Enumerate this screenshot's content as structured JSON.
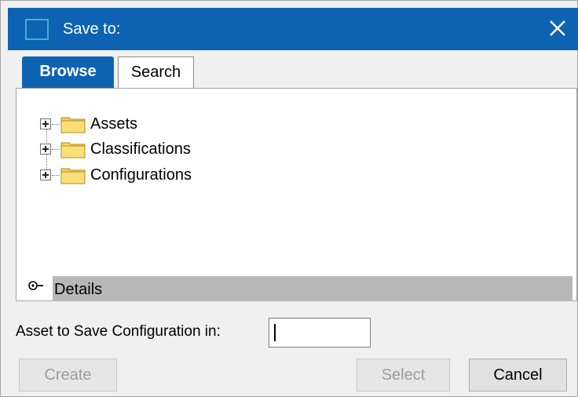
{
  "window": {
    "title": "Save to:"
  },
  "tabs": [
    {
      "label": "Browse",
      "active": true
    },
    {
      "label": "Search",
      "active": false
    }
  ],
  "tree": {
    "items": [
      {
        "label": "Assets",
        "icon": "folder-icon"
      },
      {
        "label": "Classifications",
        "icon": "folder-icon"
      },
      {
        "label": "Configurations",
        "icon": "folder-icon"
      }
    ]
  },
  "details": {
    "label": "Details"
  },
  "asset_field": {
    "label": "Asset to Save Configuration in:",
    "value": ""
  },
  "buttons": {
    "create": "Create",
    "select": "Select",
    "cancel": "Cancel"
  },
  "colors": {
    "titlebar": "#0d63b1",
    "tab_active": "#0d63b1",
    "folder": "#f7d35b",
    "details_bar": "#b8b8b8"
  }
}
